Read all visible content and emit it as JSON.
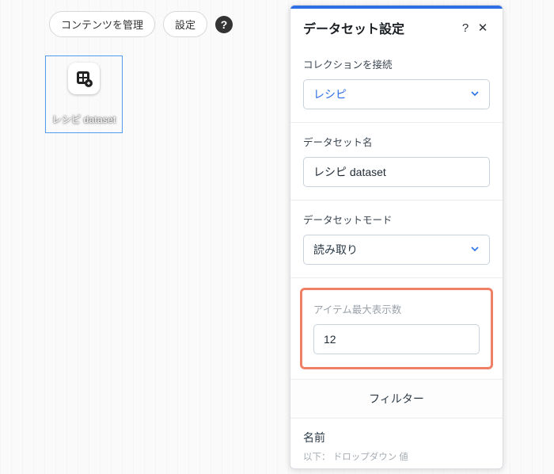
{
  "toolbar": {
    "manage_content": "コンテンツを管理",
    "settings": "設定",
    "help": "?"
  },
  "canvas_node": {
    "label": "レシピ dataset"
  },
  "panel": {
    "title": "データセット設定",
    "help": "?",
    "close": "✕",
    "connect_collection": {
      "label": "コレクションを接続",
      "value": "レシピ"
    },
    "dataset_name": {
      "label": "データセット名",
      "value": "レシピ dataset"
    },
    "mode": {
      "label": "データセットモード",
      "value": "読み取り"
    },
    "max_items": {
      "label": "アイテム最大表示数",
      "value": "12"
    },
    "filter": {
      "heading": "フィルター",
      "name": "名前",
      "desc": "以下： ドロップダウン 値"
    }
  }
}
